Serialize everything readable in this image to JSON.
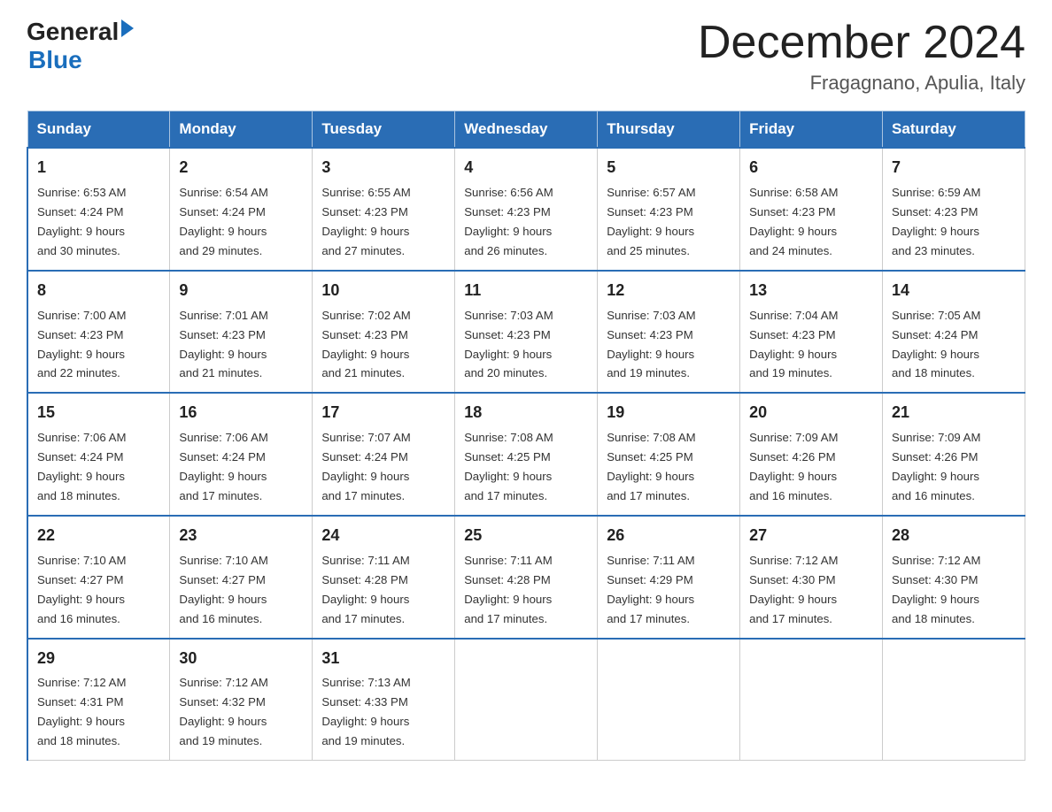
{
  "header": {
    "logo_general": "General",
    "logo_blue": "Blue",
    "month_title": "December 2024",
    "location": "Fragagnano, Apulia, Italy"
  },
  "weekdays": [
    "Sunday",
    "Monday",
    "Tuesday",
    "Wednesday",
    "Thursday",
    "Friday",
    "Saturday"
  ],
  "weeks": [
    [
      {
        "day": "1",
        "sunrise": "6:53 AM",
        "sunset": "4:24 PM",
        "daylight": "9 hours and 30 minutes."
      },
      {
        "day": "2",
        "sunrise": "6:54 AM",
        "sunset": "4:24 PM",
        "daylight": "9 hours and 29 minutes."
      },
      {
        "day": "3",
        "sunrise": "6:55 AM",
        "sunset": "4:23 PM",
        "daylight": "9 hours and 27 minutes."
      },
      {
        "day": "4",
        "sunrise": "6:56 AM",
        "sunset": "4:23 PM",
        "daylight": "9 hours and 26 minutes."
      },
      {
        "day": "5",
        "sunrise": "6:57 AM",
        "sunset": "4:23 PM",
        "daylight": "9 hours and 25 minutes."
      },
      {
        "day": "6",
        "sunrise": "6:58 AM",
        "sunset": "4:23 PM",
        "daylight": "9 hours and 24 minutes."
      },
      {
        "day": "7",
        "sunrise": "6:59 AM",
        "sunset": "4:23 PM",
        "daylight": "9 hours and 23 minutes."
      }
    ],
    [
      {
        "day": "8",
        "sunrise": "7:00 AM",
        "sunset": "4:23 PM",
        "daylight": "9 hours and 22 minutes."
      },
      {
        "day": "9",
        "sunrise": "7:01 AM",
        "sunset": "4:23 PM",
        "daylight": "9 hours and 21 minutes."
      },
      {
        "day": "10",
        "sunrise": "7:02 AM",
        "sunset": "4:23 PM",
        "daylight": "9 hours and 21 minutes."
      },
      {
        "day": "11",
        "sunrise": "7:03 AM",
        "sunset": "4:23 PM",
        "daylight": "9 hours and 20 minutes."
      },
      {
        "day": "12",
        "sunrise": "7:03 AM",
        "sunset": "4:23 PM",
        "daylight": "9 hours and 19 minutes."
      },
      {
        "day": "13",
        "sunrise": "7:04 AM",
        "sunset": "4:23 PM",
        "daylight": "9 hours and 19 minutes."
      },
      {
        "day": "14",
        "sunrise": "7:05 AM",
        "sunset": "4:24 PM",
        "daylight": "9 hours and 18 minutes."
      }
    ],
    [
      {
        "day": "15",
        "sunrise": "7:06 AM",
        "sunset": "4:24 PM",
        "daylight": "9 hours and 18 minutes."
      },
      {
        "day": "16",
        "sunrise": "7:06 AM",
        "sunset": "4:24 PM",
        "daylight": "9 hours and 17 minutes."
      },
      {
        "day": "17",
        "sunrise": "7:07 AM",
        "sunset": "4:24 PM",
        "daylight": "9 hours and 17 minutes."
      },
      {
        "day": "18",
        "sunrise": "7:08 AM",
        "sunset": "4:25 PM",
        "daylight": "9 hours and 17 minutes."
      },
      {
        "day": "19",
        "sunrise": "7:08 AM",
        "sunset": "4:25 PM",
        "daylight": "9 hours and 17 minutes."
      },
      {
        "day": "20",
        "sunrise": "7:09 AM",
        "sunset": "4:26 PM",
        "daylight": "9 hours and 16 minutes."
      },
      {
        "day": "21",
        "sunrise": "7:09 AM",
        "sunset": "4:26 PM",
        "daylight": "9 hours and 16 minutes."
      }
    ],
    [
      {
        "day": "22",
        "sunrise": "7:10 AM",
        "sunset": "4:27 PM",
        "daylight": "9 hours and 16 minutes."
      },
      {
        "day": "23",
        "sunrise": "7:10 AM",
        "sunset": "4:27 PM",
        "daylight": "9 hours and 16 minutes."
      },
      {
        "day": "24",
        "sunrise": "7:11 AM",
        "sunset": "4:28 PM",
        "daylight": "9 hours and 17 minutes."
      },
      {
        "day": "25",
        "sunrise": "7:11 AM",
        "sunset": "4:28 PM",
        "daylight": "9 hours and 17 minutes."
      },
      {
        "day": "26",
        "sunrise": "7:11 AM",
        "sunset": "4:29 PM",
        "daylight": "9 hours and 17 minutes."
      },
      {
        "day": "27",
        "sunrise": "7:12 AM",
        "sunset": "4:30 PM",
        "daylight": "9 hours and 17 minutes."
      },
      {
        "day": "28",
        "sunrise": "7:12 AM",
        "sunset": "4:30 PM",
        "daylight": "9 hours and 18 minutes."
      }
    ],
    [
      {
        "day": "29",
        "sunrise": "7:12 AM",
        "sunset": "4:31 PM",
        "daylight": "9 hours and 18 minutes."
      },
      {
        "day": "30",
        "sunrise": "7:12 AM",
        "sunset": "4:32 PM",
        "daylight": "9 hours and 19 minutes."
      },
      {
        "day": "31",
        "sunrise": "7:13 AM",
        "sunset": "4:33 PM",
        "daylight": "9 hours and 19 minutes."
      },
      null,
      null,
      null,
      null
    ]
  ],
  "labels": {
    "sunrise": "Sunrise:",
    "sunset": "Sunset:",
    "daylight": "Daylight:"
  }
}
